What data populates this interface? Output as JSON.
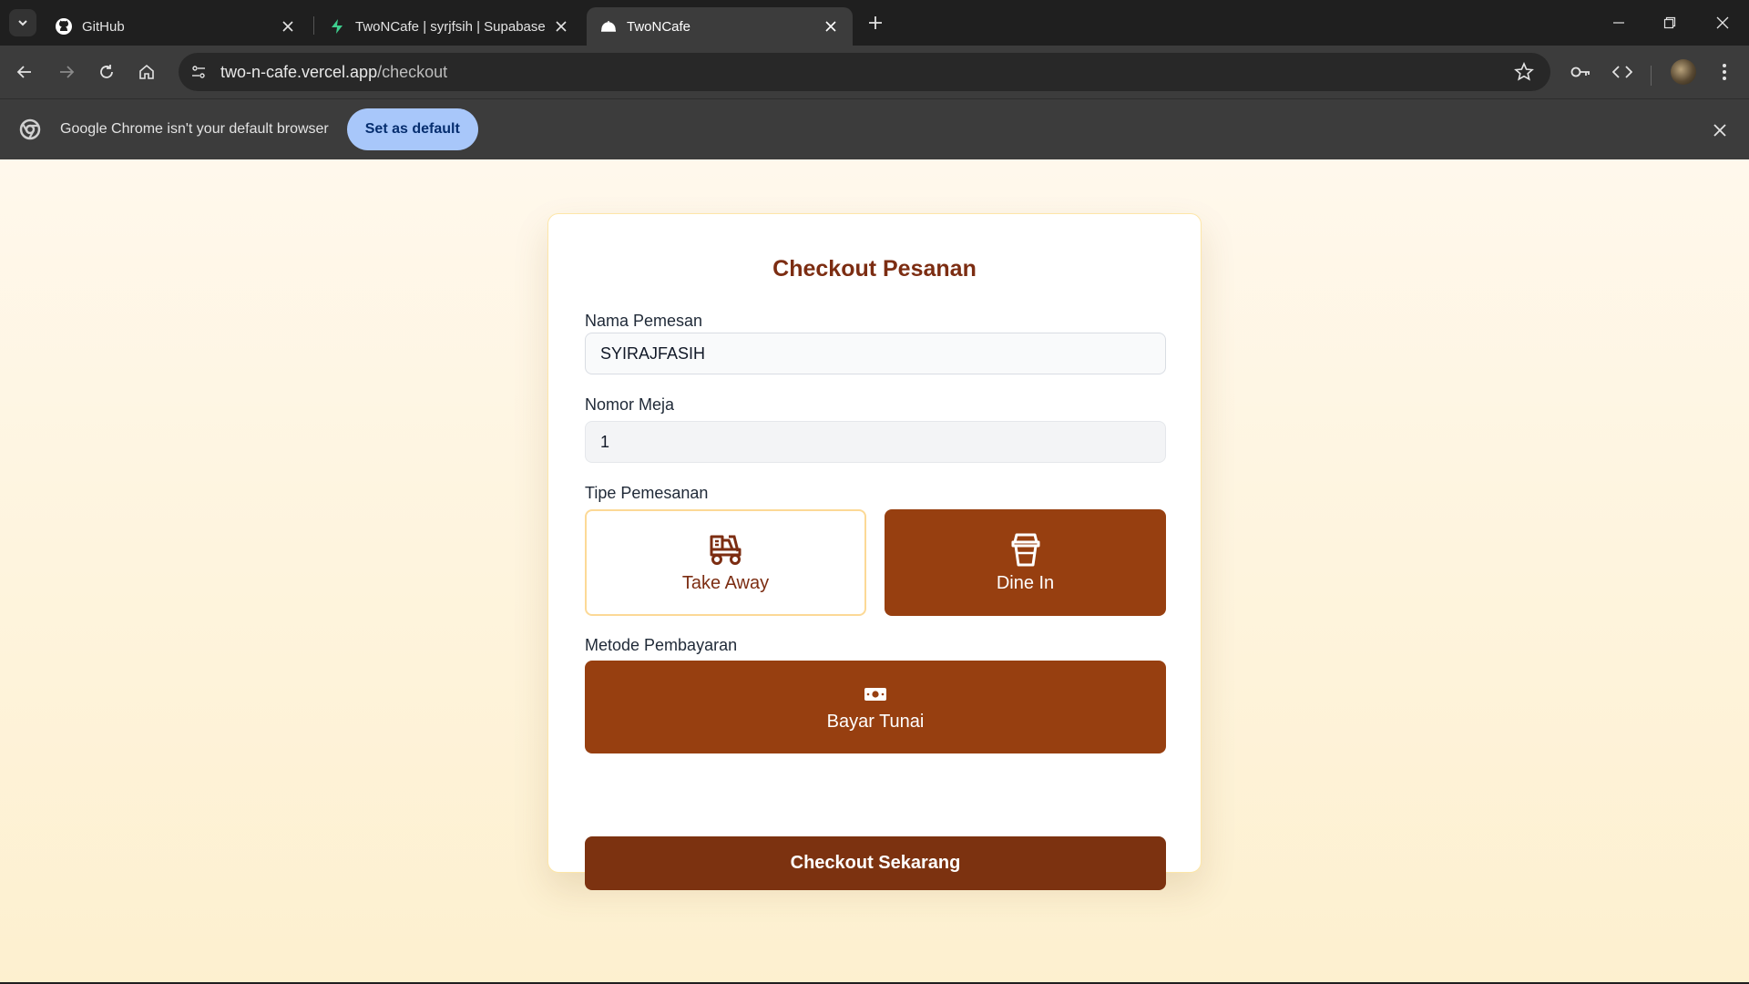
{
  "browser": {
    "tabs": [
      {
        "label": "GitHub",
        "icon": "github-icon"
      },
      {
        "label": "TwoNCafe | syrjfsih | Supabase",
        "icon": "supabase-icon"
      },
      {
        "label": "TwoNCafe",
        "icon": "cloche-icon",
        "active": true
      }
    ],
    "url_host": "two-n-cafe.vercel.app",
    "url_path": "/checkout"
  },
  "infobar": {
    "message": "Google Chrome isn't your default browser",
    "button_label": "Set as default"
  },
  "checkout": {
    "title": "Checkout Pesanan",
    "name_label": "Nama Pemesan",
    "name_value": "SYIRAJFASIH",
    "table_label": "Nomor Meja",
    "table_value": "1",
    "order_type_label": "Tipe Pemesanan",
    "order_types": [
      {
        "label": "Take Away",
        "icon": "delivery-scooter-icon",
        "selected": false
      },
      {
        "label": "Dine In",
        "icon": "cup-icon",
        "selected": true
      }
    ],
    "payment_label": "Metode Pembayaran",
    "payment_option": {
      "label": "Bayar Tunai",
      "icon": "cash-icon",
      "selected": true
    },
    "submit_label": "Checkout Sekarang"
  },
  "colors": {
    "primary": "#973f10",
    "primary_dark": "#7c3210",
    "title": "#7c2d12",
    "accent_border": "#fcd996"
  }
}
